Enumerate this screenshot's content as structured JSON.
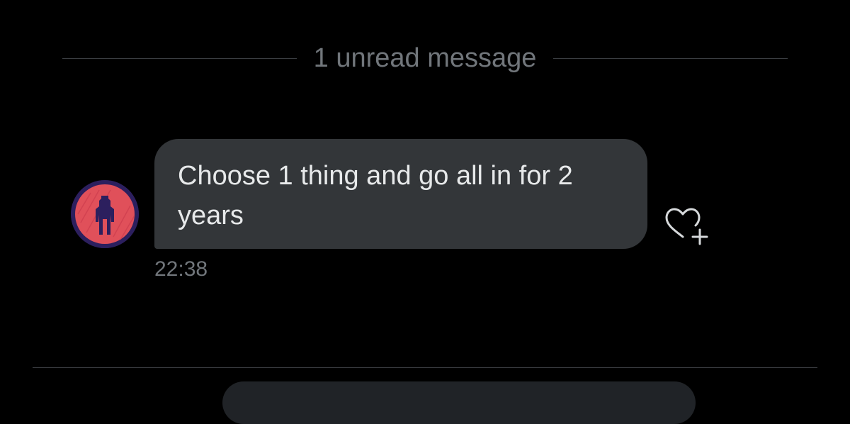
{
  "divider": {
    "label": "1 unread message"
  },
  "message": {
    "text": "Choose 1 thing and go all in for 2 years",
    "timestamp": "22:38",
    "sender_avatar_icon": "astronaut-silhouette-avatar",
    "reaction_icon": "heart-plus-icon"
  },
  "colors": {
    "background": "#000000",
    "bubble": "#333639",
    "message_text": "#e7e9ea",
    "secondary_text": "#71767b",
    "divider": "#3a3d41",
    "avatar_red": "#e0505a",
    "avatar_ring": "#2c1f5e"
  }
}
